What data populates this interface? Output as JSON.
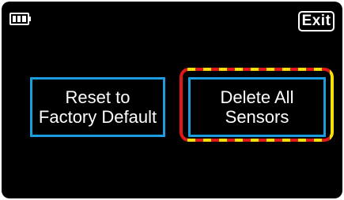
{
  "status": {
    "battery_icon": "battery-icon"
  },
  "header": {
    "exit_label": "Exit"
  },
  "buttons": {
    "reset": {
      "line1": "Reset to",
      "line2": "Factory Default"
    },
    "delete": {
      "line1": "Delete All",
      "line2": "Sensors"
    }
  },
  "colors": {
    "screen_bg": "#000000",
    "button_border": "#1a9ee0",
    "highlight_red": "#e01818",
    "highlight_yellow": "#f5e10a",
    "text": "#ffffff"
  }
}
